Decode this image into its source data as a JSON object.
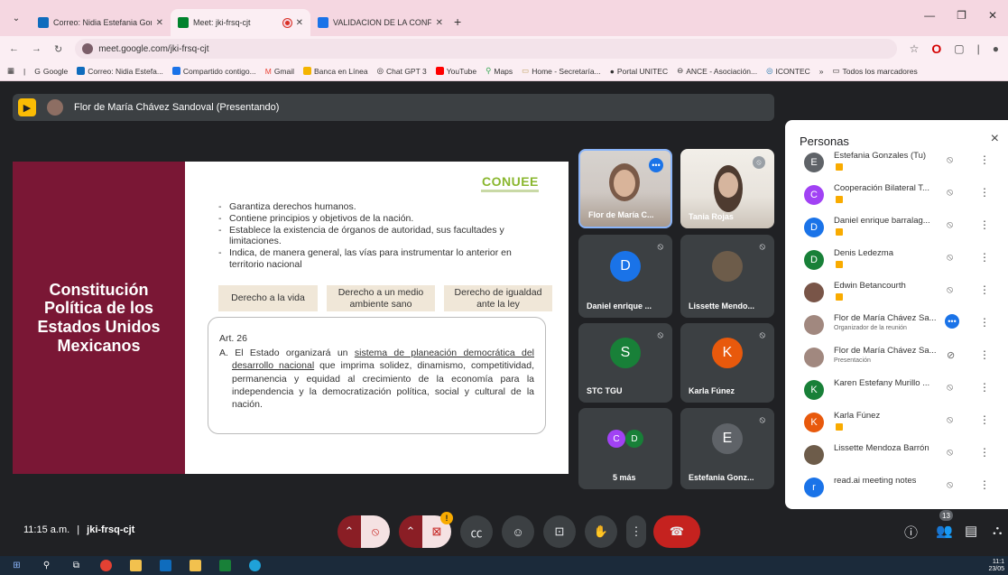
{
  "browser": {
    "tabs": [
      {
        "label": "Correo: Nidia Estefania Gonzal",
        "color": "#0f6cbd"
      },
      {
        "label": "Meet: jki-frsq-cjt",
        "color": "#00832d"
      },
      {
        "label": "VALIDACION DE LA CONFORM",
        "color": "#1a73e8"
      }
    ],
    "new_tab": "+",
    "url": "meet.google.com/jki-frsq-cjt",
    "bookmarks": [
      {
        "label": "Google",
        "color": "#4285f4"
      },
      {
        "label": "Correo: Nidia Estefa...",
        "color": "#0f6cbd"
      },
      {
        "label": "Compartido contigo...",
        "color": "#1a73e8"
      },
      {
        "label": "Gmail",
        "color": "#ea4335"
      },
      {
        "label": "Banca en Línea",
        "color": "#f4b400"
      },
      {
        "label": "Chat GPT 3",
        "color": "#555555"
      },
      {
        "label": "YouTube",
        "color": "#ff0000"
      },
      {
        "label": "Maps",
        "color": "#34a853"
      },
      {
        "label": "Home - Secretaría...",
        "color": "#c0a060"
      },
      {
        "label": "Portal UNITEC",
        "color": "#333333"
      },
      {
        "label": "ANCE - Asociación...",
        "color": "#666666"
      },
      {
        "label": "ICONTEC",
        "color": "#2a7ab0"
      },
      {
        "label": "»",
        "color": ""
      },
      {
        "label": "Todos los marcadores",
        "color": ""
      }
    ]
  },
  "meet": {
    "presenter_label": "Flor de María Chávez Sandoval (Presentando)",
    "clock": "11:15 a.m.",
    "separator": "|",
    "meeting_code": "jki-frsq-cjt",
    "people_count": "13"
  },
  "slide": {
    "side_title": "Constitución Política de los Estados Unidos Mexicanos",
    "logo": "CONUEE",
    "bullets": [
      "Garantiza derechos humanos.",
      "Contiene principios y objetivos de la nación.",
      "Establece la existencia de órganos de autoridad, sus facultades y limitaciones.",
      "Indica, de manera general, las vías para instrumentar lo anterior en territorio nacional"
    ],
    "rights": [
      "Derecho a la vida",
      "Derecho a un medio ambiente sano",
      "Derecho de igualdad ante la ley"
    ],
    "article_title": "Art. 26",
    "article_prefix": "A. El Estado organizará un ",
    "article_underlined": "sistema de planeación democrática del desarrollo nacional",
    "article_rest": " que imprima solidez, dinamismo, competitividad, permanencia y equidad al crecimiento de la economía para la independencia y la democratización política, social y cultural de la nación."
  },
  "tiles": [
    {
      "name": "Flor de María C..."
    },
    {
      "name": "Tania Rojas"
    },
    {
      "name": "Daniel enrique ...",
      "initial": "D",
      "color": "#1a73e8"
    },
    {
      "name": "Lissette Mendo..."
    },
    {
      "name": "STC TGU",
      "initial": "S",
      "color": "#188038"
    },
    {
      "name": "Karla Fúnez",
      "initial": "K",
      "color": "#e8590c"
    },
    {
      "name": "5 más",
      "initial_a": "C",
      "initial_b": "D"
    },
    {
      "name": "Estefania Gonz...",
      "initial": "E",
      "color": "#5f6368"
    }
  ],
  "panel": {
    "title": "Personas",
    "close": "×",
    "people": [
      {
        "name": "Estefania Gonzales (Tu)",
        "initial": "E",
        "color": "#5f6368",
        "badge": true
      },
      {
        "name": "Cooperación Bilateral T...",
        "initial": "C",
        "color": "#a142f4",
        "badge": true
      },
      {
        "name": "Daniel enrique barralag...",
        "initial": "D",
        "color": "#1a73e8",
        "badge": true
      },
      {
        "name": "Denis Ledezma",
        "initial": "D",
        "color": "#188038",
        "badge": true
      },
      {
        "name": "Edwin Betancourth",
        "initial": "",
        "color": "#795548",
        "badge": true
      },
      {
        "name": "Flor de María Chávez Sa...",
        "initial": "",
        "color": "#a1887f",
        "sub": "Organizador de la reunión"
      },
      {
        "name": "Flor de María Chávez Sa...",
        "initial": "",
        "color": "#a1887f",
        "sub": "Presentación"
      },
      {
        "name": "Karen Estefany Murillo ...",
        "initial": "K",
        "color": "#188038"
      },
      {
        "name": "Karla Fúnez",
        "initial": "K",
        "color": "#e8590c",
        "badge": true
      },
      {
        "name": "Lissette Mendoza Barrón",
        "initial": "",
        "color": "#6d5c4a"
      },
      {
        "name": "read.ai meeting notes",
        "initial": "r",
        "color": "#1a73e8"
      }
    ]
  },
  "taskbar": {
    "time": "11:1",
    "date": "23/05"
  }
}
